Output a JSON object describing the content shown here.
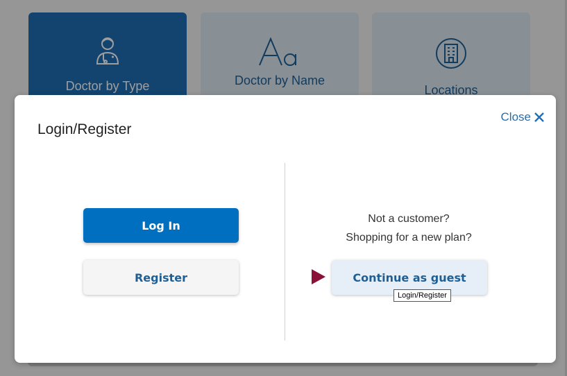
{
  "cards": [
    {
      "label": "Doctor by Type",
      "icon": "doctor-icon",
      "active": true
    },
    {
      "label": "Doctor by Name",
      "icon": "letters-aa-icon",
      "active": false
    },
    {
      "label": "Locations",
      "icon": "building-icon",
      "active": false
    }
  ],
  "modal": {
    "title": "Login/Register",
    "close_label": "Close",
    "login_label": "Log In",
    "register_label": "Register",
    "promo_line1": "Not a customer?",
    "promo_line2": "Shopping for a new plan?",
    "guest_label": "Continue as guest",
    "tooltip": "Login/Register"
  },
  "colors": {
    "primary": "#006fc0",
    "pointer": "#8a1238",
    "card_active": "#1f6fb4",
    "card_inactive": "#dde8f1"
  }
}
